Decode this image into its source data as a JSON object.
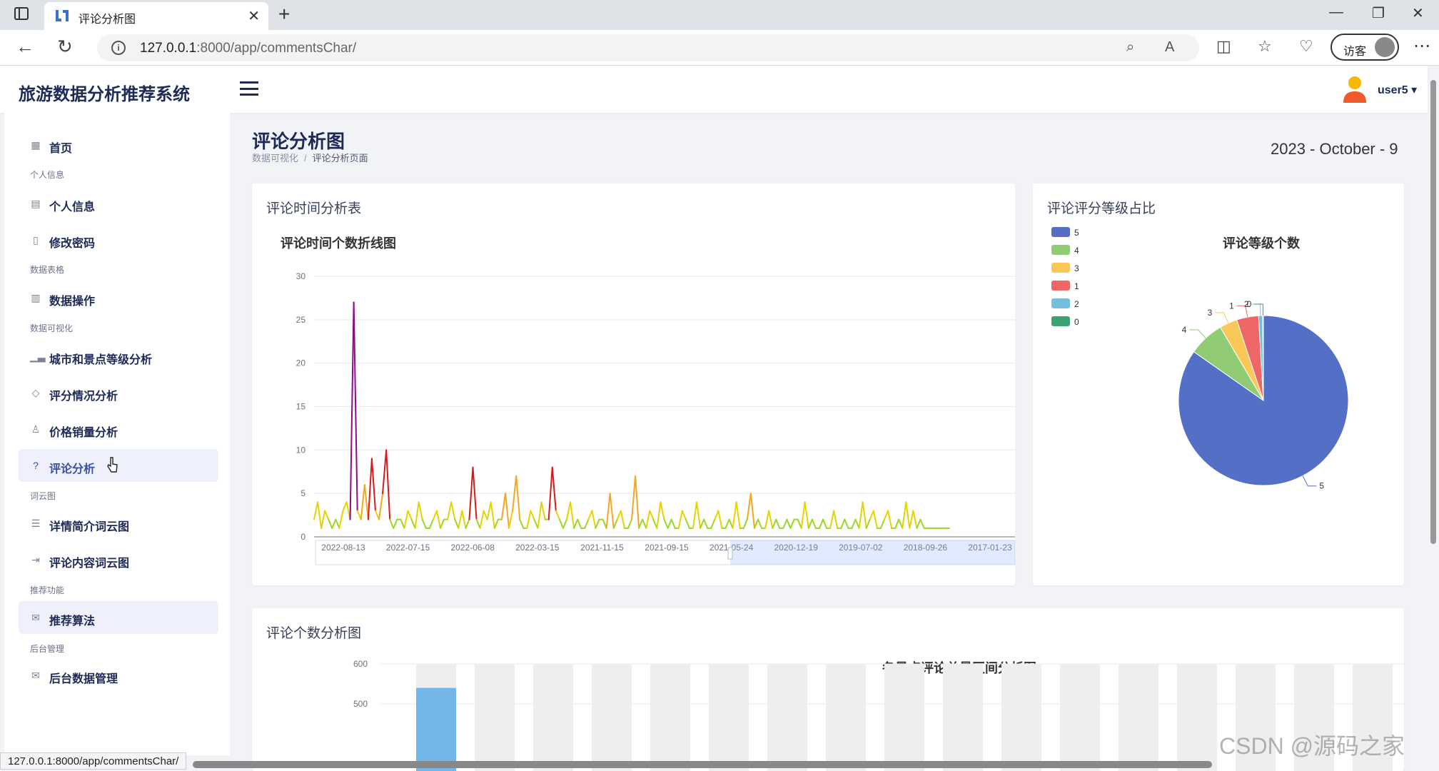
{
  "browser": {
    "tab_title": "评论分析图",
    "url_host": "127.0.0.1",
    "url_path": ":8000/app/commentsChar/",
    "guest_label": "访客",
    "status_url": "127.0.0.1:8000/app/commentsChar/"
  },
  "header": {
    "brand": "旅游数据分析推荐系统",
    "user": "user5 ▾"
  },
  "sidebar": {
    "items": [
      {
        "label": "首页",
        "icon": "grid-icon"
      },
      {
        "label": "个人信息",
        "icon": "id-card-icon"
      },
      {
        "label": "修改密码",
        "icon": "document-icon"
      },
      {
        "label": "数据操作",
        "icon": "table-icon"
      },
      {
        "label": "城市和景点等级分析",
        "icon": "bar-chart-icon"
      },
      {
        "label": "评分情况分析",
        "icon": "diamond-icon"
      },
      {
        "label": "价格销量分析",
        "icon": "user-icon"
      },
      {
        "label": "评论分析",
        "icon": "question-circle-icon"
      },
      {
        "label": "详情简介词云图",
        "icon": "list-icon"
      },
      {
        "label": "评论内容词云图",
        "icon": "login-icon"
      },
      {
        "label": "推荐算法",
        "icon": "mail-icon"
      },
      {
        "label": "后台数据管理",
        "icon": "mail-icon"
      }
    ],
    "sections": [
      "个人信息",
      "数据表格",
      "数据可视化",
      "词云图",
      "推荐功能",
      "后台管理"
    ]
  },
  "page": {
    "title": "评论分析图",
    "breadcrumb_parent": "数据可视化",
    "breadcrumb_sep": "/",
    "breadcrumb_current": "评论分析页面",
    "date": "2023 - October - 9"
  },
  "cards": {
    "time_card_title": "评论时间分析表",
    "pie_card_title": "评论评分等级占比",
    "count_card_title": "评论个数分析图"
  },
  "chart_data": [
    {
      "type": "line",
      "title": "评论时间个数折线图",
      "x_ticks": [
        "2022-08-13",
        "2022-07-15",
        "2022-06-08",
        "2022-03-15",
        "2021-11-15",
        "2021-09-15",
        "2021-05-24",
        "2020-12-19",
        "2019-07-02",
        "2018-09-26",
        "2017-01-23"
      ],
      "yticks": [
        0,
        5,
        10,
        15,
        20,
        25,
        30
      ],
      "ylim": [
        0,
        30
      ],
      "series": [
        {
          "values": [
            2,
            4,
            1,
            3,
            2,
            1,
            2,
            1,
            3,
            4,
            2,
            27,
            3,
            2,
            6,
            2,
            9,
            3,
            2,
            5,
            10,
            2,
            1,
            2,
            2,
            1,
            3,
            2,
            1,
            4,
            2,
            1,
            1,
            2,
            3,
            1,
            2,
            2,
            4,
            2,
            1,
            3,
            1,
            2,
            8,
            2,
            1,
            3,
            2,
            4,
            1,
            2,
            2,
            5,
            1,
            3,
            7,
            2,
            1,
            1,
            3,
            2,
            1,
            4,
            2,
            2,
            8,
            3,
            2,
            1,
            2,
            4,
            1,
            2,
            1,
            1,
            2,
            3,
            1,
            2,
            2,
            1,
            5,
            1,
            2,
            3,
            1,
            1,
            2,
            7,
            1,
            2,
            1,
            3,
            2,
            1,
            4,
            2,
            1,
            2,
            1,
            1,
            3,
            2,
            1,
            1,
            4,
            1,
            2,
            1,
            1,
            2,
            3,
            1,
            1,
            2,
            1,
            4,
            1,
            1,
            2,
            5,
            1,
            2,
            1,
            1,
            3,
            1,
            2,
            1,
            1,
            2,
            1,
            2,
            2,
            1,
            4,
            1,
            2,
            1,
            1,
            2,
            1,
            1,
            3,
            1,
            1,
            2,
            1,
            1,
            2,
            1,
            4,
            1,
            2,
            3,
            1,
            1,
            2,
            3,
            1,
            1,
            2,
            1,
            4,
            1,
            3,
            1,
            2,
            1,
            1,
            1,
            1,
            1,
            1,
            1,
            1
          ]
        }
      ]
    },
    {
      "type": "pie",
      "title": "评论等级个数",
      "legend": [
        "5",
        "4",
        "3",
        "1",
        "2",
        "0"
      ],
      "colors": [
        "#5470c6",
        "#91cc75",
        "#fac858",
        "#ee6666",
        "#73c0de",
        "#3ba272"
      ],
      "values": [
        1120,
        90,
        45,
        55,
        10,
        2
      ]
    },
    {
      "type": "bar",
      "title": "各景点评论总量区间分析图",
      "yticks": [
        500,
        600
      ],
      "visible_first_value": 540
    }
  ]
}
